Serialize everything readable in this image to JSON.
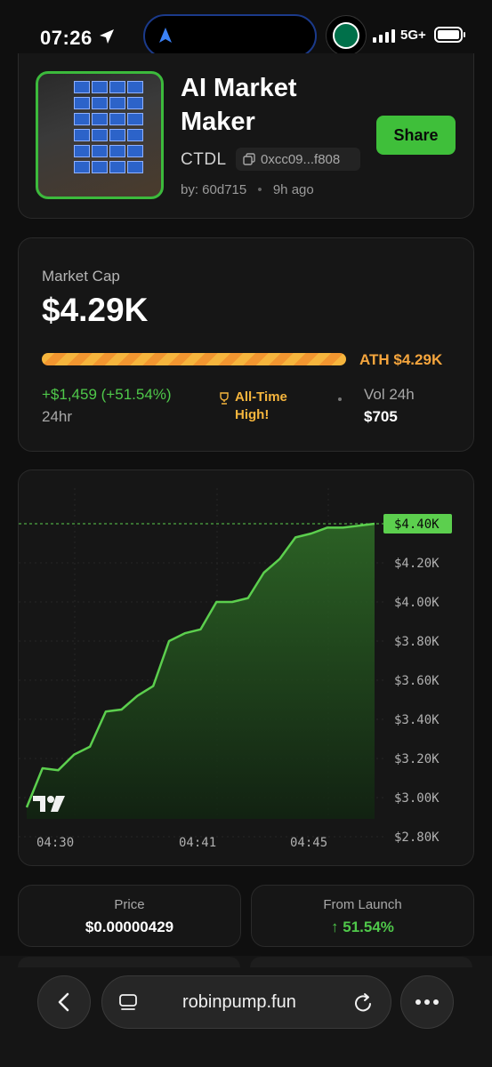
{
  "status_bar": {
    "time": "07:26",
    "network": "5G+"
  },
  "token": {
    "name": "AI Market Maker",
    "ticker": "CTDL",
    "address": "0xcc09...f808",
    "creator": "by: 60d715",
    "age": "9h ago",
    "share_label": "Share"
  },
  "market": {
    "label": "Market Cap",
    "value": "$4.29K",
    "ath_label": "ATH $4.29K",
    "ath_progress": 1.0,
    "change": "+$1,459 (+51.54%)",
    "change_period": "24hr",
    "badge_line1": "All-Time",
    "badge_line2": "High!",
    "vol_label": "Vol 24h",
    "vol_value": "$705"
  },
  "chart_data": {
    "type": "area",
    "x_ticks": [
      "04:30",
      "04:41",
      "04:45"
    ],
    "y_ticks": [
      "$4.20K",
      "$4.00K",
      "$3.80K",
      "$3.60K",
      "$3.40K",
      "$3.20K",
      "$3.00K",
      "$2.80K"
    ],
    "ylim": [
      2.8,
      4.4
    ],
    "last_price_label": "$4.40K",
    "last_price": 4.4,
    "points": [
      2.95,
      3.15,
      3.14,
      3.22,
      3.26,
      3.44,
      3.45,
      3.52,
      3.57,
      3.8,
      3.84,
      3.86,
      4.0,
      4.0,
      4.02,
      4.15,
      4.22,
      4.33,
      4.35,
      4.38,
      4.38,
      4.39,
      4.4
    ],
    "colors": {
      "line": "#5ccf4e",
      "fill_top": "#2f6e27",
      "fill_bottom": "#112411"
    }
  },
  "stats": [
    {
      "label": "Price",
      "value": "$0.00000429",
      "color": "#ffffff"
    },
    {
      "label": "From Launch",
      "value": "↑ 51.54%",
      "color": "#4fc84a"
    }
  ],
  "browser": {
    "url": "robinpump.fun"
  },
  "icons": {
    "navigation": "location-arrow-icon",
    "copy": "copy-icon",
    "trophy": "trophy-icon",
    "back": "chevron-left-icon",
    "tabs": "tabs-icon",
    "reload": "reload-icon",
    "more": "more-icon",
    "chart_logo": "tradingview-logo-icon"
  }
}
